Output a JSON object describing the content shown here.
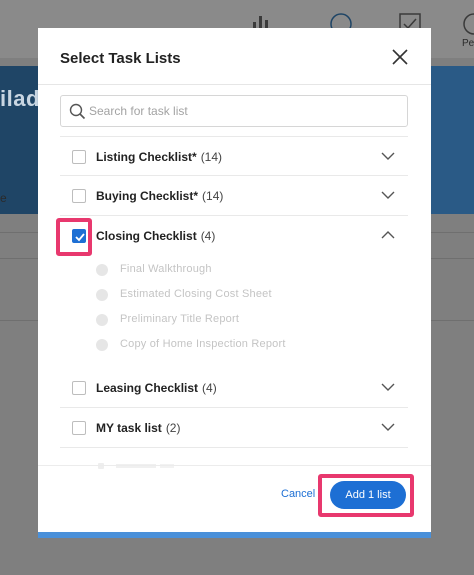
{
  "background": {
    "banner_text": "ilade",
    "row_text": "e",
    "people_label": "Pe"
  },
  "modal": {
    "title": "Select Task Lists",
    "search": {
      "placeholder": "Search for task list",
      "value": ""
    },
    "lists": [
      {
        "label": "Listing Checklist*",
        "count": "(14)",
        "checked": false,
        "expanded": false
      },
      {
        "label": "Buying Checklist*",
        "count": "(14)",
        "checked": false,
        "expanded": false
      },
      {
        "label": "Closing Checklist",
        "count": "(4)",
        "checked": true,
        "expanded": true,
        "items": [
          "Final Walkthrough",
          "Estimated Closing Cost Sheet",
          "Preliminary Title Report",
          "Copy of Home Inspection Report"
        ]
      },
      {
        "label": "Leasing Checklist",
        "count": "(4)",
        "checked": false,
        "expanded": false
      },
      {
        "label": "MY task list",
        "count": "(2)",
        "checked": false,
        "expanded": false
      }
    ],
    "footer": {
      "cancel_label": "Cancel",
      "add_label": "Add 1 list"
    }
  },
  "colors": {
    "accent": "#1d6fd4",
    "highlight": "#e8386e",
    "bottom_bar": "#4a90d9"
  },
  "icons": [
    "bar-chart-icon",
    "user-circle-icon",
    "checkbox-icon",
    "people-icon",
    "close-icon",
    "search-icon",
    "chevron-down-icon",
    "chevron-up-icon",
    "check-icon"
  ]
}
